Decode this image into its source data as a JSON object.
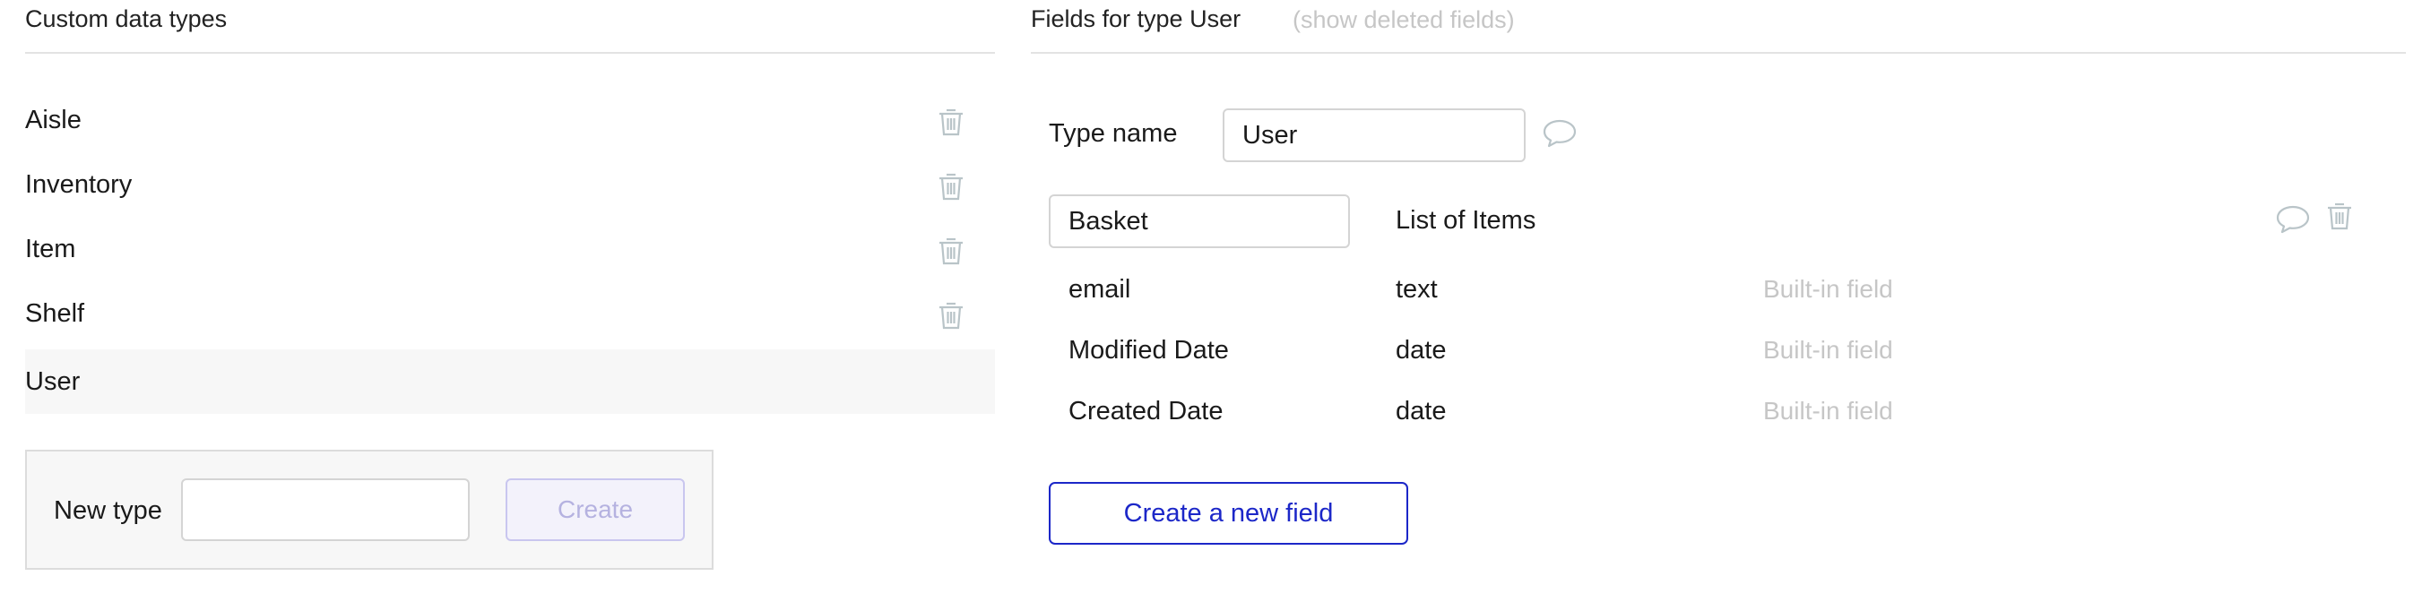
{
  "left_panel": {
    "title": "Custom data types",
    "types": [
      {
        "label": "Aisle",
        "deletable": true
      },
      {
        "label": "Inventory",
        "deletable": true
      },
      {
        "label": "Item",
        "deletable": true
      },
      {
        "label": "Shelf",
        "deletable": true
      },
      {
        "label": "User",
        "deletable": false,
        "selected": true
      }
    ],
    "new_type": {
      "label": "New type",
      "input_value": "",
      "create_label": "Create"
    }
  },
  "right_panel": {
    "title": "Fields for type User",
    "show_deleted_link": "(show deleted fields)",
    "type_name_label": "Type name",
    "type_name_value": "User",
    "fields": [
      {
        "name": "Basket",
        "type": "List of Items",
        "note": "",
        "editable": true
      },
      {
        "name": "email",
        "type": "text",
        "note": "Built-in field",
        "editable": false
      },
      {
        "name": "Modified Date",
        "type": "date",
        "note": "Built-in field",
        "editable": false
      },
      {
        "name": "Created Date",
        "type": "date",
        "note": "Built-in field",
        "editable": false
      }
    ],
    "create_field_label": "Create a new field"
  },
  "colors": {
    "accent": "#1c27c8",
    "icon_gray": "#b9c4c8",
    "muted_text": "#c6c6c6",
    "selected_row_bg": "#f7f7f7"
  },
  "icons": {
    "delete": "trash-icon",
    "comment": "speech-bubble-icon"
  }
}
